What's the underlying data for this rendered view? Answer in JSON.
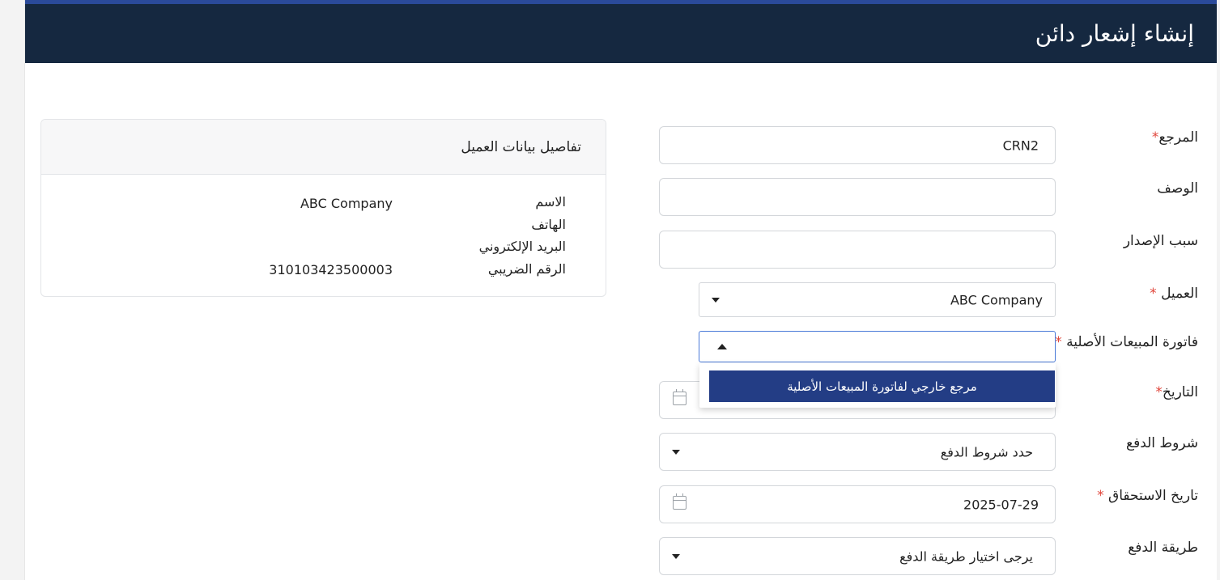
{
  "header": {
    "title": "إنشاء إشعار دائن"
  },
  "form": {
    "reference": {
      "label": "المرجع",
      "required_mark": "*",
      "value": "CRN2"
    },
    "description": {
      "label": "الوصف",
      "value": ""
    },
    "issue_reason": {
      "label": "سبب الإصدار",
      "value": ""
    },
    "customer": {
      "label": "العميل",
      "required_mark": "*",
      "value": "ABC Company"
    },
    "original_invoice": {
      "label": "فاتورة المبيعات الأصلية",
      "required_mark": "*",
      "value": "",
      "options": [
        "مرجع خارجي لفاتورة المبيعات الأصلية"
      ]
    },
    "date": {
      "label": "التاريخ",
      "required_mark": "*",
      "value": ""
    },
    "payment_terms": {
      "label": "شروط الدفع",
      "value": "حدد شروط الدفع"
    },
    "due_date": {
      "label": "تاريخ الاستحقاق",
      "required_mark": "*",
      "value": "2025-07-29"
    },
    "payment_method": {
      "label": "طريقة الدفع",
      "value": "يرجى اختيار طريقة الدفع"
    }
  },
  "customer_panel": {
    "title": "تفاصيل بيانات العميل",
    "rows": [
      {
        "label": "الاسم",
        "value": "ABC Company"
      },
      {
        "label": "الهاتف",
        "value": ""
      },
      {
        "label": "البريد الإلكتروني",
        "value": ""
      },
      {
        "label": "الرقم الضريبي",
        "value": "310103423500003"
      }
    ]
  },
  "colors": {
    "header_bg": "#152840",
    "header_border": "#2a4a9a",
    "selected_option_bg": "#233d85",
    "required_mark": "#e0453a",
    "focus_border": "#4a7ad8"
  },
  "icons": {
    "dropdown": "caret-down-icon",
    "dropdown_open": "caret-up-icon",
    "date": "calendar-icon"
  }
}
